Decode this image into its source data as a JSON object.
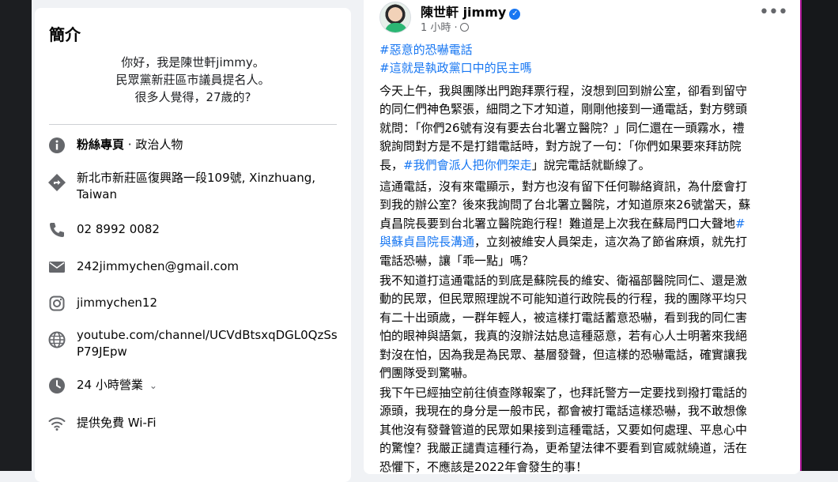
{
  "intro": {
    "title": "簡介",
    "bio": [
      "你好，我是陳世軒jimmy。",
      "民眾黨新莊區市議員提名人。",
      "很多人覺得，27歲的?"
    ],
    "category_bold": "粉絲專頁",
    "category_rest": " · 政治人物",
    "address": [
      "新北市新莊區復興路一段109號, Xinzhuang,",
      "Taiwan"
    ],
    "phone": "02 8992 0082",
    "email": "242jimmychen@gmail.com",
    "instagram": "jimmychen12",
    "youtube": [
      "youtube.com/channel/UCVdBtsxqDGL0QzSs",
      "P79JEpw"
    ],
    "hours": "24 小時營業",
    "wifi": "提供免費 Wi-Fi"
  },
  "post": {
    "author": "陳世軒 jimmy",
    "time": "1 小時 ·",
    "more_label": "•••",
    "hashtags": [
      "#惡意的恐嚇電話",
      "#這就是執政黨口中的民主嗎"
    ],
    "p1": [
      "今天上午，我與團隊出門跑拜票行程，沒想到回到辦公室，卻看到留守",
      "的同仁們神色緊張，細問之下才知道，剛剛他接到一通電話，對方劈頭",
      "就問：「你們26號有沒有要去台北署立醫院？」同仁還在一頭霧水，禮",
      "貌詢問對方是不是打錯電話時，對方說了一句：「你們如果要來拜訪院",
      "長，",
      "#我們會派人把你們架走",
      "」說完電話就斷線了。"
    ],
    "p2": [
      "這通電話，沒有來電顯示，對方也沒有留下任何聯絡資訊，為什麼會打",
      "到我的辦公室？後來我詢問了台北署立醫院，才知道原來26號當天，蘇",
      "貞昌院長要到台北署立醫院跑行程！難道是上次我在蘇局門口大聲地",
      "#",
      "與蘇貞昌院長溝通",
      "，立刻被維安人員架走，這次為了節省麻煩，就先打",
      "電話恐嚇，讓「乖一點」嗎？"
    ],
    "p3": [
      "我不知道打這通電話的到底是蘇院長的維安、衛福部醫院同仁、還是激",
      "動的民眾，但民眾照理說不可能知道行政院長的行程，我的團隊平均只",
      "有二十出頭歲，一群年輕人，被這樣打電話蓄意恐嚇，看到我的同仁害",
      "怕的眼神與語氣，我真的沒辦法姑息這種惡意，若有心人士明著來我絕",
      "對沒在怕，因為我是為民眾、基層發聲，但這樣的恐嚇電話，確實讓我",
      "們團隊受到驚嚇。"
    ],
    "p4": [
      "我下午已經抽空前往偵查隊報案了，也拜託警方一定要找到撥打電話的",
      "源頭，我現在的身分是一般市民，都會被打電話這樣恐嚇，我不敢想像",
      "其他沒有發聲管道的民眾如果接到這種電話，又要如何處理、平息心中",
      "的驚惶？我嚴正譴責這種行為，更希望法律不要看到官威就繞道，活在",
      "恐懼下，不應該是2022年會發生的事！"
    ]
  }
}
